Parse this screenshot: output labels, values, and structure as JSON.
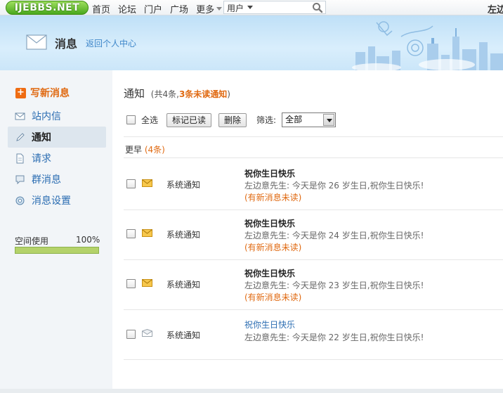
{
  "nav": {
    "logo": "IJEBBS.NET",
    "items": [
      "首页",
      "论坛",
      "门户",
      "广场"
    ],
    "more": "更多",
    "search_scope": "用户",
    "user": "左边"
  },
  "banner": {
    "title": "消息",
    "back_link": "返回个人中心"
  },
  "sidebar": {
    "compose": "写新消息",
    "items": [
      {
        "label": "站内信",
        "icon": "envelope-icon"
      },
      {
        "label": "通知",
        "icon": "pencil-icon"
      },
      {
        "label": "请求",
        "icon": "document-icon"
      },
      {
        "label": "群消息",
        "icon": "chat-icon"
      },
      {
        "label": "消息设置",
        "icon": "settings-icon"
      }
    ],
    "active_index": 1,
    "quota_label": "空间使用",
    "quota_value": "100%",
    "quota_fraction": 1.0
  },
  "main": {
    "title": "通知",
    "summary_prefix": "(共4条,",
    "summary_unread": "3条未读通知",
    "summary_suffix": ")",
    "select_all": "全选",
    "mark_read": "标记已读",
    "delete": "删除",
    "filter_label": "筛选:",
    "filter_value": "全部",
    "group_label": "更早",
    "group_count": "(4条)",
    "notices": [
      {
        "sender": "系统通知",
        "subject": "祝你生日快乐",
        "body": "左边意先生: 今天是你 26 岁生日,祝你生日快乐!",
        "flag": "(有新消息未读)",
        "unread": true
      },
      {
        "sender": "系统通知",
        "subject": "祝你生日快乐",
        "body": "左边意先生: 今天是你 24 岁生日,祝你生日快乐!",
        "flag": "(有新消息未读)",
        "unread": true
      },
      {
        "sender": "系统通知",
        "subject": "祝你生日快乐",
        "body": "左边意先生: 今天是你 23 岁生日,祝你生日快乐!",
        "flag": "(有新消息未读)",
        "unread": true
      },
      {
        "sender": "系统通知",
        "subject": "祝你生日快乐",
        "body": "左边意先生: 今天是你 22 岁生日,祝你生日快乐!",
        "flag": "",
        "unread": false
      }
    ]
  },
  "colors": {
    "accent": "#e06a12",
    "link": "#2b6db2",
    "quota": "#b4d26a"
  }
}
